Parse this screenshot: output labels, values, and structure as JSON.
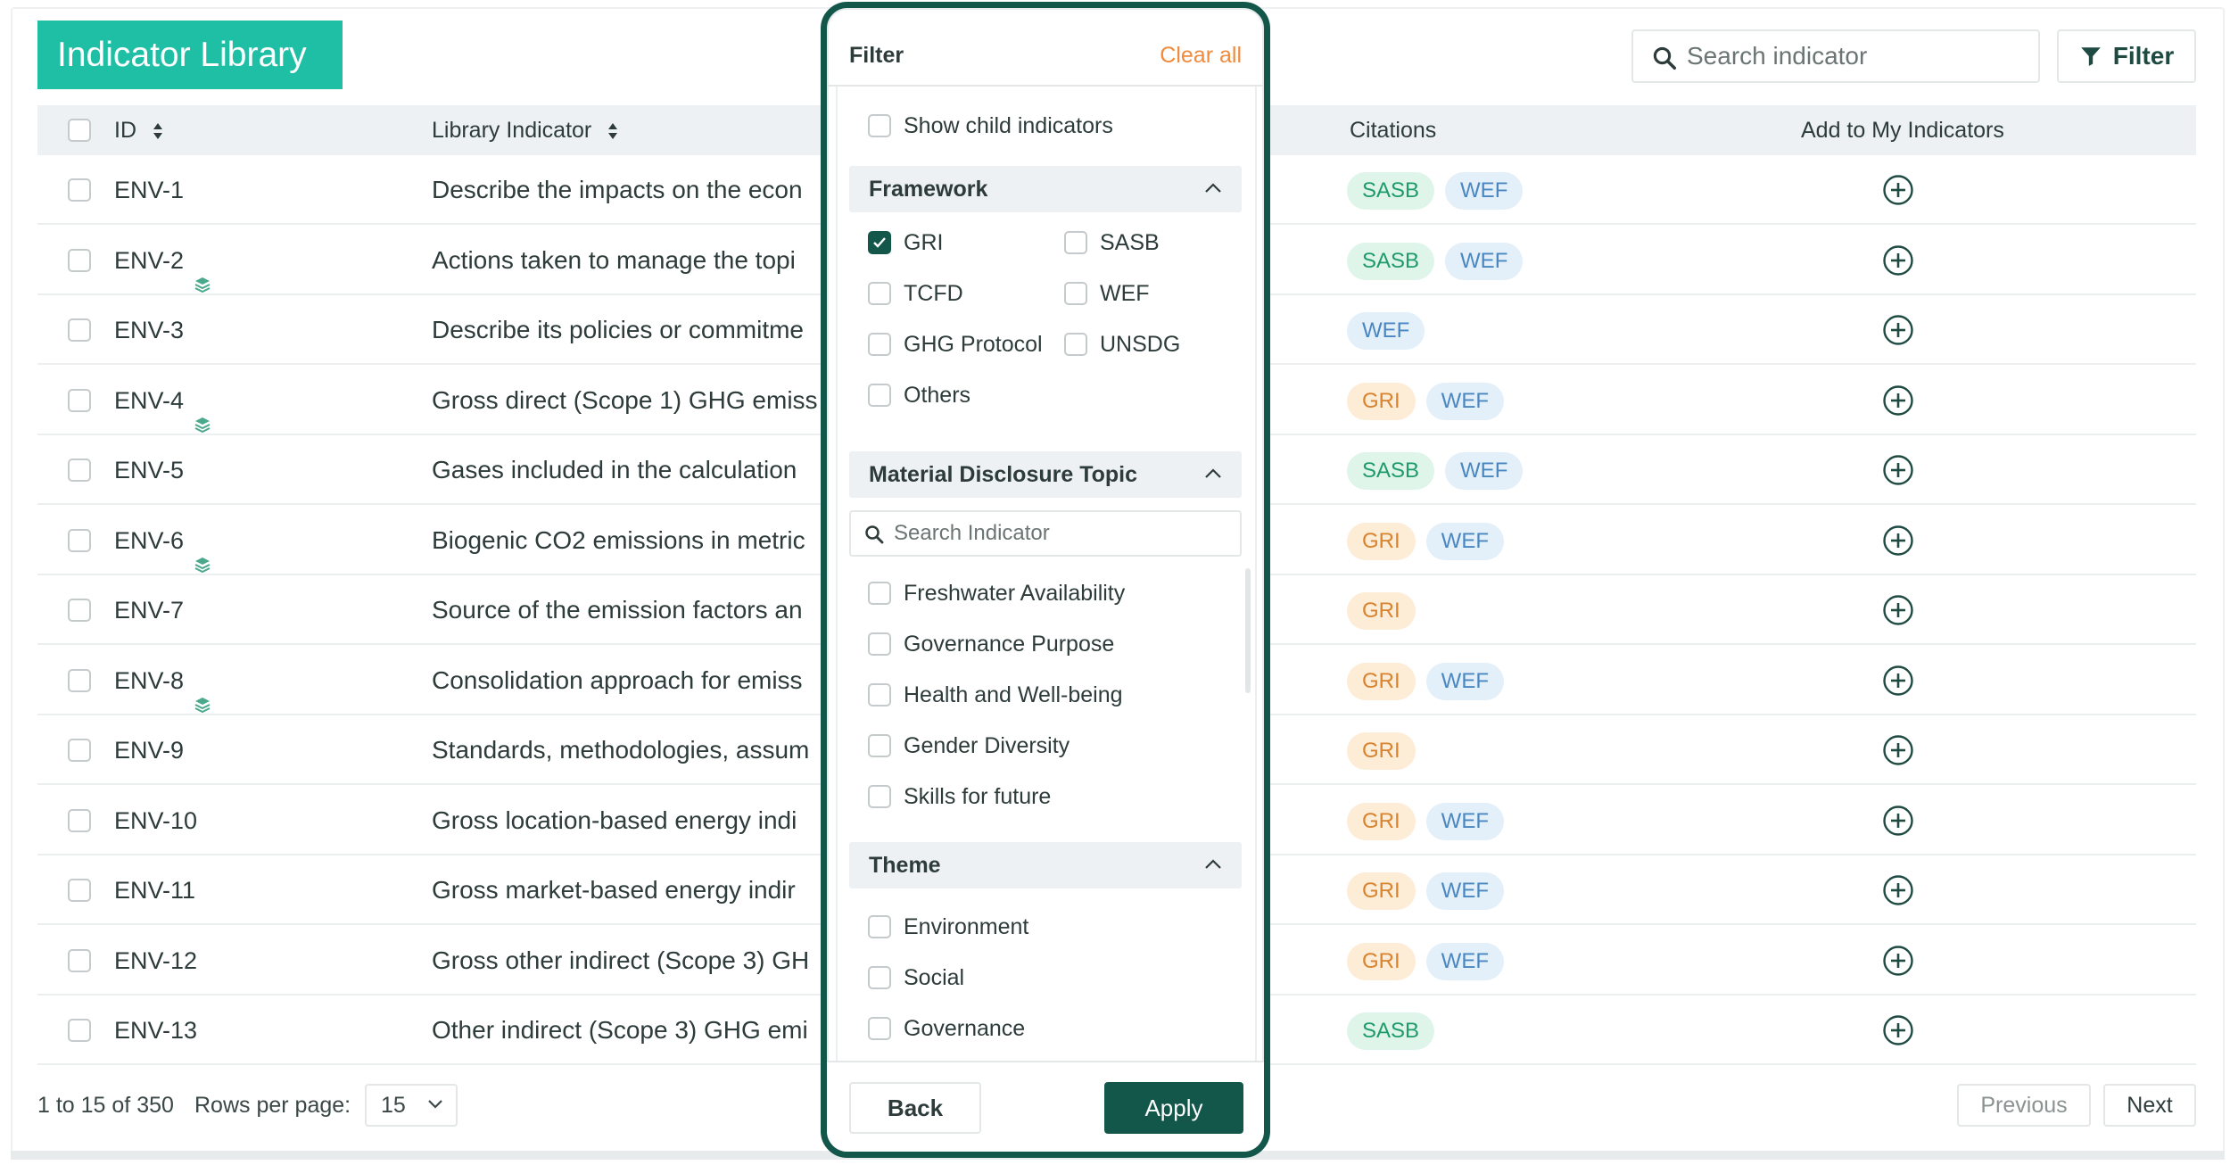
{
  "header": {
    "title": "Indicator Library",
    "search_placeholder": "Search indicator",
    "filter_label": "Filter"
  },
  "table": {
    "columns": {
      "id": "ID",
      "indicator": "Library Indicator",
      "citations": "Citations",
      "add": "Add to My Indicators"
    },
    "rows": [
      {
        "id": "ENV-1",
        "layer": false,
        "text": "Describe the impacts on the econ",
        "tags": [
          "SASB",
          "WEF"
        ]
      },
      {
        "id": "ENV-2",
        "layer": true,
        "text": "Actions taken to manage the topi",
        "tags": [
          "SASB",
          "WEF"
        ]
      },
      {
        "id": "ENV-3",
        "layer": false,
        "text": "Describe its policies or commitme",
        "tags": [
          "WEF"
        ]
      },
      {
        "id": "ENV-4",
        "layer": true,
        "text": "Gross direct (Scope 1) GHG emiss",
        "tags": [
          "GRI",
          "WEF"
        ]
      },
      {
        "id": "ENV-5",
        "layer": false,
        "text": "Gases included in the calculation",
        "tags": [
          "SASB",
          "WEF"
        ]
      },
      {
        "id": "ENV-6",
        "layer": true,
        "text": "Biogenic CO2 emissions in metric",
        "tags": [
          "GRI",
          "WEF"
        ]
      },
      {
        "id": "ENV-7",
        "layer": false,
        "text": "Source of the emission factors an",
        "tags": [
          "GRI"
        ]
      },
      {
        "id": "ENV-8",
        "layer": true,
        "text": "Consolidation approach for emiss",
        "tags": [
          "GRI",
          "WEF"
        ]
      },
      {
        "id": "ENV-9",
        "layer": false,
        "text": "Standards, methodologies, assum",
        "tags": [
          "GRI"
        ]
      },
      {
        "id": "ENV-10",
        "layer": false,
        "text": "Gross location-based energy indi",
        "tags": [
          "GRI",
          "WEF"
        ]
      },
      {
        "id": "ENV-11",
        "layer": false,
        "text": "Gross market-based energy indir",
        "tags": [
          "GRI",
          "WEF"
        ]
      },
      {
        "id": "ENV-12",
        "layer": false,
        "text": " Gross other indirect (Scope 3) GH",
        "tags": [
          "GRI",
          "WEF"
        ]
      },
      {
        "id": "ENV-13",
        "layer": false,
        "text": "Other indirect (Scope 3) GHG emi",
        "tags": [
          "SASB"
        ]
      }
    ]
  },
  "pagination": {
    "count": "1 to 15 of 350",
    "rows_per_page_label": "Rows per page:",
    "rows_per_page_value": "15",
    "previous": "Previous",
    "next": "Next"
  },
  "filter_panel": {
    "title": "Filter",
    "clear_all": "Clear all",
    "show_child": "Show child indicators",
    "framework": {
      "label": "Framework",
      "options": [
        {
          "label": "GRI",
          "checked": true
        },
        {
          "label": "SASB",
          "checked": false
        },
        {
          "label": "TCFD",
          "checked": false
        },
        {
          "label": "WEF",
          "checked": false
        },
        {
          "label": "GHG Protocol",
          "checked": false
        },
        {
          "label": "UNSDG",
          "checked": false
        },
        {
          "label": "Others",
          "checked": false
        }
      ]
    },
    "topic": {
      "label": "Material Disclosure Topic",
      "search_placeholder": "Search Indicator",
      "options": [
        "Freshwater Availability",
        "Governance Purpose",
        "Health and Well-being",
        "Gender Diversity",
        "Skills for future"
      ]
    },
    "theme": {
      "label": "Theme",
      "options": [
        "Environment",
        "Social",
        "Governance"
      ]
    },
    "back": "Back",
    "apply": "Apply"
  },
  "colors": {
    "brand": "#1fbfa6",
    "dark_green": "#13564a",
    "accent_orange": "#f08a3c"
  }
}
